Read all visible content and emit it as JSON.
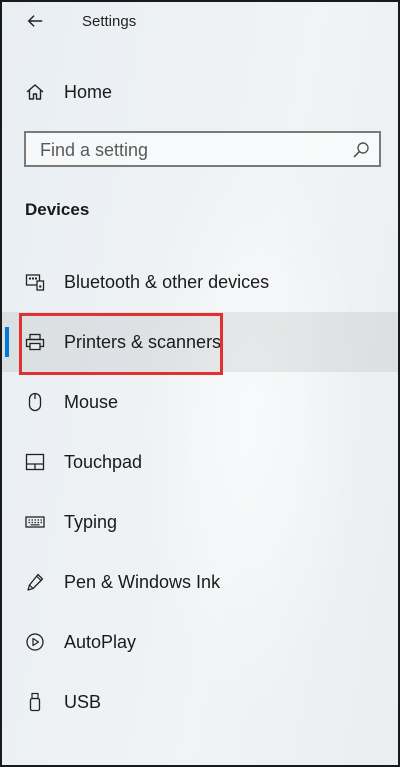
{
  "window": {
    "title": "Settings"
  },
  "home": {
    "label": "Home"
  },
  "search": {
    "placeholder": "Find a setting",
    "value": ""
  },
  "section": {
    "heading": "Devices"
  },
  "nav": {
    "items": [
      {
        "label": "Bluetooth & other devices",
        "icon": "bluetooth-devices-icon",
        "selected": false
      },
      {
        "label": "Printers & scanners",
        "icon": "printer-icon",
        "selected": true
      },
      {
        "label": "Mouse",
        "icon": "mouse-icon",
        "selected": false
      },
      {
        "label": "Touchpad",
        "icon": "touchpad-icon",
        "selected": false
      },
      {
        "label": "Typing",
        "icon": "keyboard-icon",
        "selected": false
      },
      {
        "label": "Pen & Windows Ink",
        "icon": "pen-icon",
        "selected": false
      },
      {
        "label": "AutoPlay",
        "icon": "autoplay-icon",
        "selected": false
      },
      {
        "label": "USB",
        "icon": "usb-icon",
        "selected": false
      }
    ]
  },
  "colors": {
    "accent": "#0078d7",
    "highlight_box": "#e0312e",
    "text": "#1a1a1a"
  }
}
